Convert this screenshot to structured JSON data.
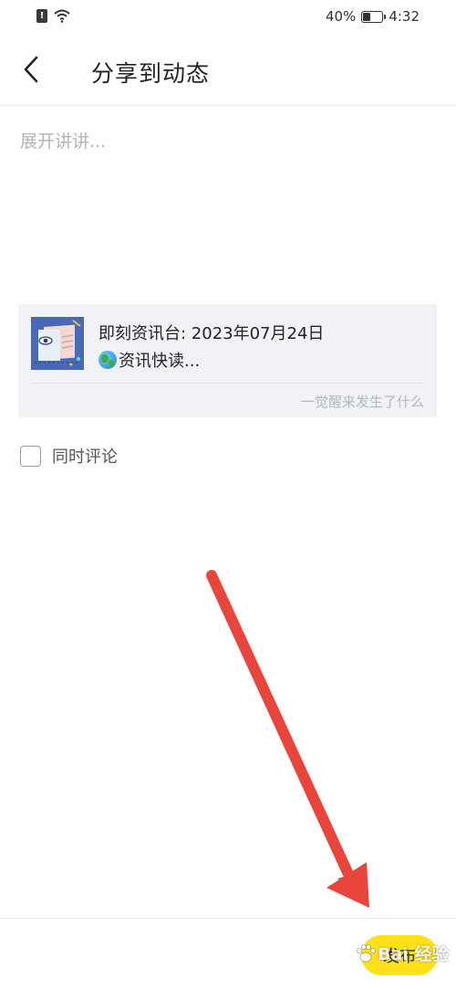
{
  "status_bar": {
    "sim_badge": "!",
    "battery_percent": "40%",
    "battery_level": 0.4,
    "time": "4:32"
  },
  "nav": {
    "title": "分享到动态"
  },
  "composer": {
    "placeholder": "展开讲讲..."
  },
  "share_card": {
    "title": "即刻资讯台: 2023年07月24日",
    "desc": "资讯快读...",
    "source": "一觉醒来发生了什么"
  },
  "options": {
    "comment_label": "同时评论",
    "comment_checked": false
  },
  "bottom": {
    "publish_label": "发布"
  },
  "watermark": {
    "text": "Bai  经验"
  },
  "colors": {
    "publish_button": "#ffe11a",
    "annotation_arrow": "#e8453c",
    "card_background": "#f0f2f5"
  }
}
